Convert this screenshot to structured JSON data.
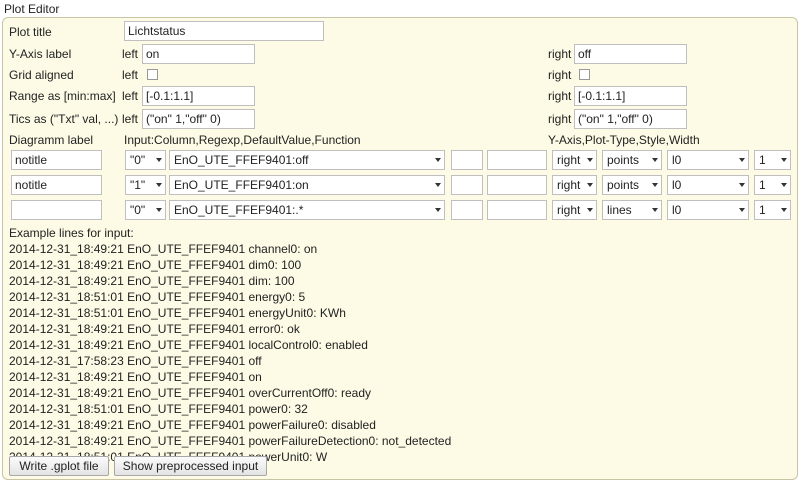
{
  "window": {
    "title": "Plot Editor"
  },
  "plot_title": {
    "label": "Plot title",
    "value": "Lichtstatus"
  },
  "yaxis": {
    "label": "Y-Axis label",
    "left_prefix": "left",
    "left_value": "on",
    "right_prefix": "right",
    "right_value": "off"
  },
  "grid": {
    "label": "Grid aligned",
    "left_prefix": "left",
    "right_prefix": "right"
  },
  "range": {
    "label": "Range as [min:max]",
    "left_prefix": "left",
    "left_value": "[-0.1:1.1]",
    "right_prefix": "right",
    "right_value": "[-0.1:1.1]"
  },
  "tics": {
    "label": "Tics as (\"Txt\" val, ...)",
    "left_prefix": "left",
    "left_value": "(\"on\" 1,\"off\" 0)",
    "right_prefix": "right",
    "right_value": "(\"on\" 1,\"off\" 0)"
  },
  "headers": {
    "diagramm_label": "Diagramm label",
    "input": "Input:Column,Regexp,DefaultValue,Function",
    "yaxis_plot": "Y-Axis,Plot-Type,Style,Width"
  },
  "rows": [
    {
      "label": "notitle",
      "column": "\"0\"",
      "regexp": "EnO_UTE_FFEF9401:off",
      "default": "",
      "function": "",
      "axis": "right",
      "plot_type": "points",
      "style": "l0",
      "width": "1"
    },
    {
      "label": "notitle",
      "column": "\"1\"",
      "regexp": "EnO_UTE_FFEF9401:on",
      "default": "",
      "function": "",
      "axis": "right",
      "plot_type": "points",
      "style": "l0",
      "width": "1"
    },
    {
      "label": "",
      "column": "\"0\"",
      "regexp": "EnO_UTE_FFEF9401:.*",
      "default": "",
      "function": "",
      "axis": "right",
      "plot_type": "lines",
      "style": "l0",
      "width": "1"
    }
  ],
  "examples": {
    "heading": "Example lines for input:",
    "lines": [
      "2014-12-31_18:49:21 EnO_UTE_FFEF9401 channel0: on",
      "2014-12-31_18:49:21 EnO_UTE_FFEF9401 dim0: 100",
      "2014-12-31_18:49:21 EnO_UTE_FFEF9401 dim: 100",
      "2014-12-31_18:51:01 EnO_UTE_FFEF9401 energy0: 5",
      "2014-12-31_18:51:01 EnO_UTE_FFEF9401 energyUnit0: KWh",
      "2014-12-31_18:49:21 EnO_UTE_FFEF9401 error0: ok",
      "2014-12-31_18:49:21 EnO_UTE_FFEF9401 localControl0: enabled",
      "2014-12-31_17:58:23 EnO_UTE_FFEF9401 off",
      "2014-12-31_18:49:21 EnO_UTE_FFEF9401 on",
      "2014-12-31_18:49:21 EnO_UTE_FFEF9401 overCurrentOff0: ready",
      "2014-12-31_18:51:01 EnO_UTE_FFEF9401 power0: 32",
      "2014-12-31_18:49:21 EnO_UTE_FFEF9401 powerFailure0: disabled",
      "2014-12-31_18:49:21 EnO_UTE_FFEF9401 powerFailureDetection0: not_detected",
      "2014-12-31_18:51:01 EnO_UTE_FFEF9401 powerUnit0: W"
    ]
  },
  "buttons": {
    "write": "Write .gplot file",
    "show": "Show preprocessed input"
  }
}
